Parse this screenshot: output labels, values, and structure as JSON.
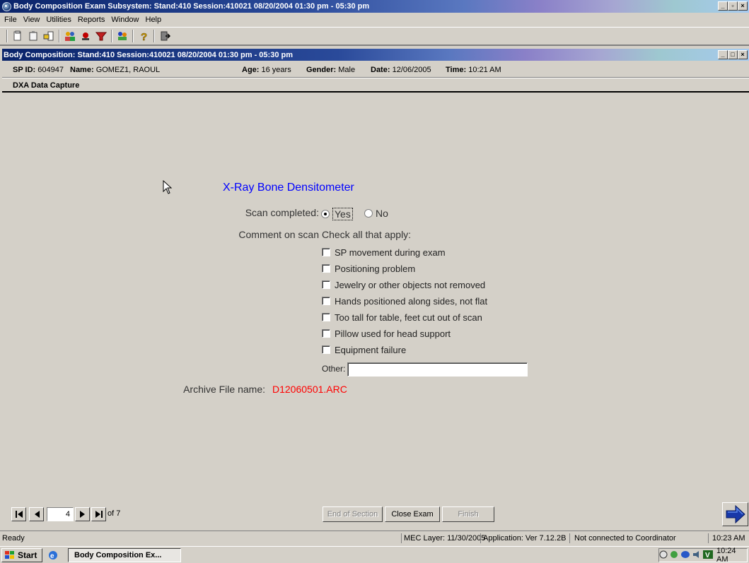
{
  "outer_window": {
    "title": "Body Composition Exam Subsystem: Stand:410 Session:410021 08/20/2004 01:30 pm - 05:30 pm",
    "min": "_",
    "max": "▫",
    "close": "×"
  },
  "menu": {
    "items": [
      "File",
      "View",
      "Utilities",
      "Reports",
      "Window",
      "Help"
    ]
  },
  "toolbar": {
    "icons": [
      "new-icon",
      "clipboard-icon",
      "transfer-icon",
      "users-icon",
      "record-icon",
      "filter-icon",
      "people-icon",
      "help-icon",
      "exit-icon"
    ]
  },
  "inner_window": {
    "title": "Body Composition: Stand:410 Session:410021 08/20/2004 01:30 pm - 05:30 pm",
    "min": "_",
    "max": "□",
    "close": "×"
  },
  "participant": {
    "sp_id_label": "SP ID:",
    "sp_id": "604947",
    "name_label": "Name:",
    "name": "GOMEZ1, RAOUL",
    "age_label": "Age:",
    "age": "16 years",
    "gender_label": "Gender:",
    "gender": "Male",
    "date_label": "Date:",
    "date": "12/06/2005",
    "time_label": "Time:",
    "time": "10:21 AM"
  },
  "section": {
    "title": "DXA Data Capture"
  },
  "form": {
    "title": "X-Ray Bone Densitometer",
    "scan_completed_label": "Scan completed:",
    "yes_label": "Yes",
    "no_label": "No",
    "selected": "Yes",
    "comment_label": "Comment on scan",
    "check_instruction": "Check all that apply:",
    "checkboxes": [
      {
        "label": "SP movement during exam",
        "checked": false
      },
      {
        "label": "Positioning problem",
        "checked": false
      },
      {
        "label": "Jewelry or other objects not removed",
        "checked": false
      },
      {
        "label": "Hands positioned along sides, not flat",
        "checked": false
      },
      {
        "label": "Too tall for table, feet cut out of scan",
        "checked": false
      },
      {
        "label": "Pillow used for head support",
        "checked": false
      },
      {
        "label": "Equipment failure",
        "checked": false
      }
    ],
    "other_label": "Other:",
    "other_value": "",
    "archive_label": "Archive File name:",
    "archive_value": "D12060501.ARC"
  },
  "nav": {
    "current_page": "4",
    "of_pages": "of 7",
    "end_of_section": "End of Section",
    "close_exam": "Close Exam",
    "finish": "Finish"
  },
  "status": {
    "left": "Ready",
    "mec_layer": "MEC Layer: 11/30/2005",
    "application": "Application: Ver 7.12.2B",
    "coordinator": "Not connected to Coordinator",
    "time": "10:23 AM"
  },
  "taskbar": {
    "start": "Start",
    "task": "Body Composition Ex...",
    "clock": "10:24 AM"
  },
  "colors": {
    "title_dark": "#0a246a",
    "form_title": "#0000ff",
    "archive_value": "#ff0000",
    "face": "#d4d0c8"
  }
}
